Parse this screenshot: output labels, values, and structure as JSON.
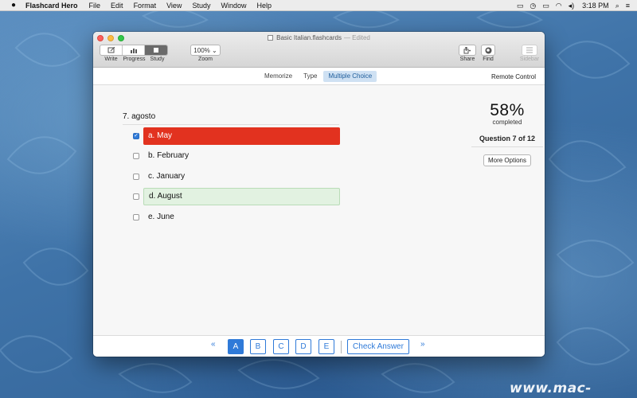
{
  "menubar": {
    "app_name": "Flashcard Hero",
    "items": [
      "File",
      "Edit",
      "Format",
      "View",
      "Study",
      "Window",
      "Help"
    ],
    "clock": "3:18 PM"
  },
  "window": {
    "title": "Basic Italian.flashcards",
    "edited": "— Edited",
    "toolbar": {
      "write_label": "Write",
      "progress_label": "Progress",
      "study_label": "Study",
      "zoom_value": "100% ⌄",
      "zoom_label": "Zoom",
      "share_label": "Share",
      "find_label": "Find",
      "sidebar_label": "Sidebar"
    }
  },
  "modes": {
    "tabs": [
      "Memorize",
      "Type",
      "Multiple Choice"
    ],
    "active": "Multiple Choice",
    "remote": "Remote Control"
  },
  "quiz": {
    "question": "7. agosto",
    "options": [
      {
        "text": "a. May",
        "checked": true,
        "state": "wrong"
      },
      {
        "text": "b. February",
        "checked": false,
        "state": "none"
      },
      {
        "text": "c. January",
        "checked": false,
        "state": "none"
      },
      {
        "text": "d. August",
        "checked": false,
        "state": "correct"
      },
      {
        "text": "e. June",
        "checked": false,
        "state": "none"
      }
    ]
  },
  "progress": {
    "percent": "58%",
    "completed_label": "completed",
    "question_count": "Question 7 of 12",
    "more_options": "More Options"
  },
  "answer_bar": {
    "prev": "«",
    "next": "»",
    "letters": [
      "A",
      "B",
      "C",
      "D",
      "E"
    ],
    "selected": "A",
    "check_label": "Check Answer"
  },
  "watermark": "www.mac-gm.com",
  "colors": {
    "accent": "#2f7ad8",
    "wrong": "#e2321f",
    "correct": "#e2f2e1",
    "desktop": "#3f73a8"
  }
}
